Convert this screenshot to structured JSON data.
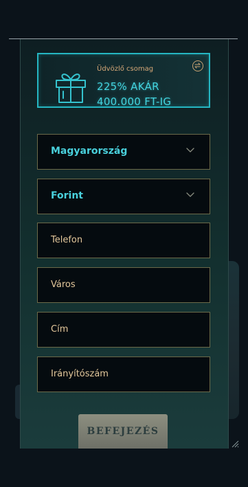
{
  "bonus": {
    "label": "Üdvözlő csomag",
    "line1": "225% AKÁR",
    "line2": "400.000 FT-IG",
    "accent_color": "#43d4df",
    "icons": {
      "gift": "gift-icon",
      "swap": "swap-icon"
    }
  },
  "form": {
    "country": {
      "value": "Magyarország",
      "icon": "chevron-down-icon"
    },
    "currency": {
      "value": "Forint",
      "icon": "chevron-down-icon"
    },
    "phone": {
      "placeholder": "Telefon"
    },
    "city": {
      "placeholder": "Város"
    },
    "address": {
      "placeholder": "Cím"
    },
    "postcode": {
      "placeholder": "Irányítószám"
    }
  },
  "submit": {
    "label": "BEFEJEZÉS"
  }
}
